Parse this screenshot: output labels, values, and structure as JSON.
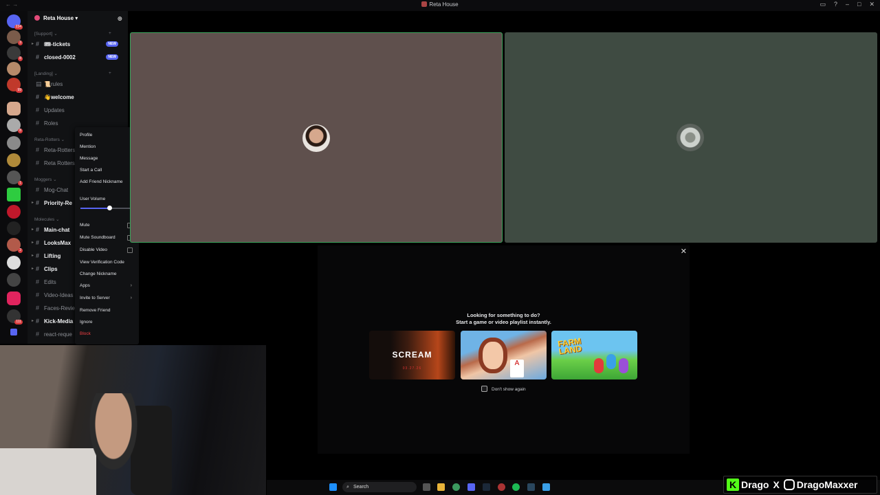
{
  "window": {
    "title": "Reta House"
  },
  "server": {
    "name": "Reta House",
    "categories": [
      {
        "label": "[Support]"
      },
      {
        "label": "[Landing]"
      },
      {
        "label": "Reta-Rotters"
      },
      {
        "label": "Moggers"
      },
      {
        "label": "Molecules"
      }
    ],
    "channels": [
      {
        "label": "🎟-tickets",
        "badge": "NEW"
      },
      {
        "label": "closed-0002",
        "badge": "NEW"
      },
      {
        "label": "📜rules"
      },
      {
        "label": "👋welcome"
      },
      {
        "label": "Updates"
      },
      {
        "label": "Roles"
      },
      {
        "label": "Reta-Rotters"
      },
      {
        "label": "Reta Rotters"
      },
      {
        "label": "Mog-Chat"
      },
      {
        "label": "Priority-Re"
      },
      {
        "label": "Main-chat"
      },
      {
        "label": "LooksMax"
      },
      {
        "label": "Lifting"
      },
      {
        "label": "Clips"
      },
      {
        "label": "Edits"
      },
      {
        "label": "Video-Ideas"
      },
      {
        "label": "Faces-Review"
      },
      {
        "label": "Kick-Media"
      },
      {
        "label": "react-reque"
      }
    ],
    "rail_badges": [
      "234",
      "3",
      "8",
      "99",
      "8",
      "1",
      "2",
      "111"
    ]
  },
  "context_menu": {
    "profile": "Profile",
    "mention": "Mention",
    "message": "Message",
    "start_call": "Start a Call",
    "add_nickname": "Add Friend Nickname",
    "user_volume": "User Volume",
    "user_volume_level": 0.55,
    "mute": "Mute",
    "mute_soundboard": "Mute Soundboard",
    "disable_video": "Disable Video",
    "view_verification": "View Verification Code",
    "change_nickname": "Change Nickname",
    "apps": "Apps",
    "invite": "Invite to Server",
    "remove_friend": "Remove Friend",
    "ignore": "Ignore",
    "block": "Block"
  },
  "activity": {
    "line1": "Looking for something to do?",
    "line2": "Start a game or video playlist instantly.",
    "game1_title": "SCREAM",
    "game1_sub": "03.27.26",
    "game2_card": "A",
    "game3_logo_1": "FARM",
    "game3_logo_2": "LAND",
    "dont_show": "Don't show again"
  },
  "taskbar": {
    "search": "Search"
  },
  "overlay": {
    "kick_handle": "Drago",
    "ig_handle": "DragoMaxxer",
    "kick_letter": "K",
    "x": "X"
  },
  "colors": {
    "accent": "#5865f2",
    "speaking": "#3ba55c",
    "danger": "#f23f43",
    "tile1": "#5f504d",
    "tile2": "#3f4b42",
    "kick": "#53fc18"
  }
}
